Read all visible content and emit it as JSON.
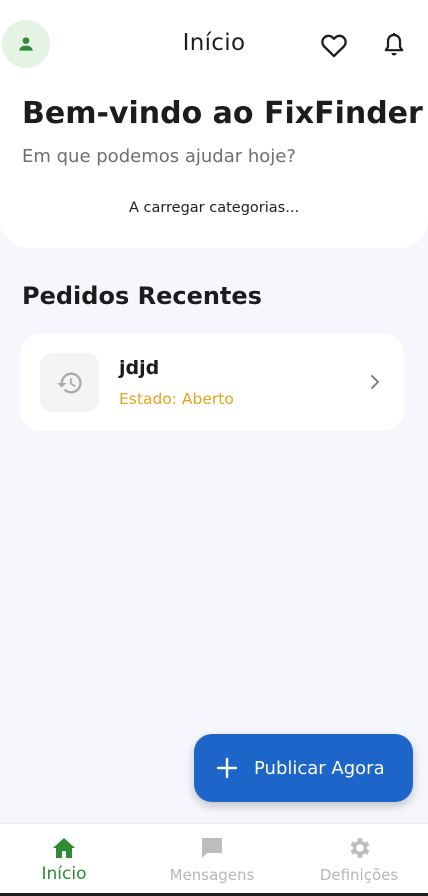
{
  "app_bar": {
    "title": "Início"
  },
  "header": {
    "welcome": "Bem-vindo ao FixFinder",
    "subtitle": "Em que podemos ajudar hoje?",
    "loading": "A carregar categorias..."
  },
  "recent": {
    "title": "Pedidos Recentes",
    "items": [
      {
        "title": "jdjd",
        "status": "Estado: Aberto"
      }
    ]
  },
  "fab": {
    "label": "Publicar Agora"
  },
  "bottom_nav": {
    "items": [
      {
        "label": "Início",
        "active": true
      },
      {
        "label": "Mensagens",
        "active": false
      },
      {
        "label": "Definições",
        "active": false
      }
    ]
  },
  "colors": {
    "accent_green": "#2e8b33",
    "fab_blue": "#1d65c8",
    "status_open": "#e8a41c"
  }
}
